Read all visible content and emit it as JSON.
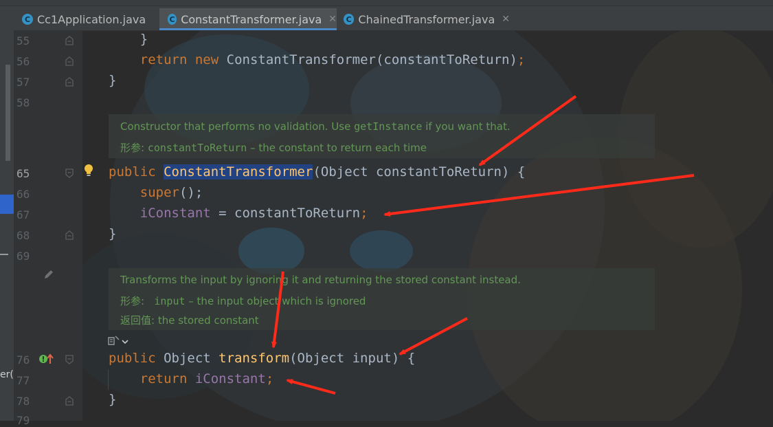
{
  "tabs": [
    {
      "label": "Cc1Application.java",
      "icon": "class-icon",
      "active": false
    },
    {
      "label": "ConstantTransformer.java",
      "icon": "class-icon",
      "active": true
    },
    {
      "label": "ChainedTransformer.java",
      "icon": "class-icon",
      "active": false
    }
  ],
  "left_panel": {
    "clipped_text": "er("
  },
  "line_numbers": [
    "55",
    "56",
    "57",
    "58",
    "65",
    "66",
    "67",
    "68",
    "69",
    "76",
    "77",
    "78",
    "79"
  ],
  "code": {
    "l55": {
      "brace": "}"
    },
    "l56": {
      "kw_return": "return",
      "kw_new": "new",
      "type": "ConstantTransformer",
      "args": "(constantToReturn)",
      "semi": ";"
    },
    "l57": {
      "brace": "}"
    },
    "l65": {
      "kw_public": "public",
      "ctor": "ConstantTransformer",
      "params": "(Object constantToReturn) {"
    },
    "l66": {
      "kw_super": "super",
      "rest": "();"
    },
    "l67": {
      "field": "iConstant",
      "assign": " = constantToReturn",
      "semi": ";"
    },
    "l68": {
      "brace": "}"
    },
    "l76": {
      "kw_public": "public",
      "type": " Object ",
      "method": "transform",
      "params": "(Object input) {"
    },
    "l77": {
      "kw_return": "return",
      "field": "iConstant",
      "semi": ";"
    },
    "l78": {
      "brace": "}"
    }
  },
  "docs": {
    "ctor": {
      "line1_pre": "Constructor that performs no validation. Use ",
      "line1_code": "getInstance",
      "line1_post": " if you want that.",
      "param_label": "形参: ",
      "param_name": "constantToReturn",
      "param_desc": " – the constant to return each time"
    },
    "transform": {
      "line1": "Transforms the input by ignoring it and returning the stored constant instead.",
      "param_label": "形参:   ",
      "param_name": "input",
      "param_desc": " – the input object which is ignored",
      "return_label": "返回值: ",
      "return_desc": "the stored constant"
    }
  },
  "colors": {
    "keyword": "#cc7832",
    "method": "#ffc66d",
    "field": "#9876aa",
    "doc": "#629755",
    "selection": "#214283",
    "arrow": "#ff2a1a"
  }
}
